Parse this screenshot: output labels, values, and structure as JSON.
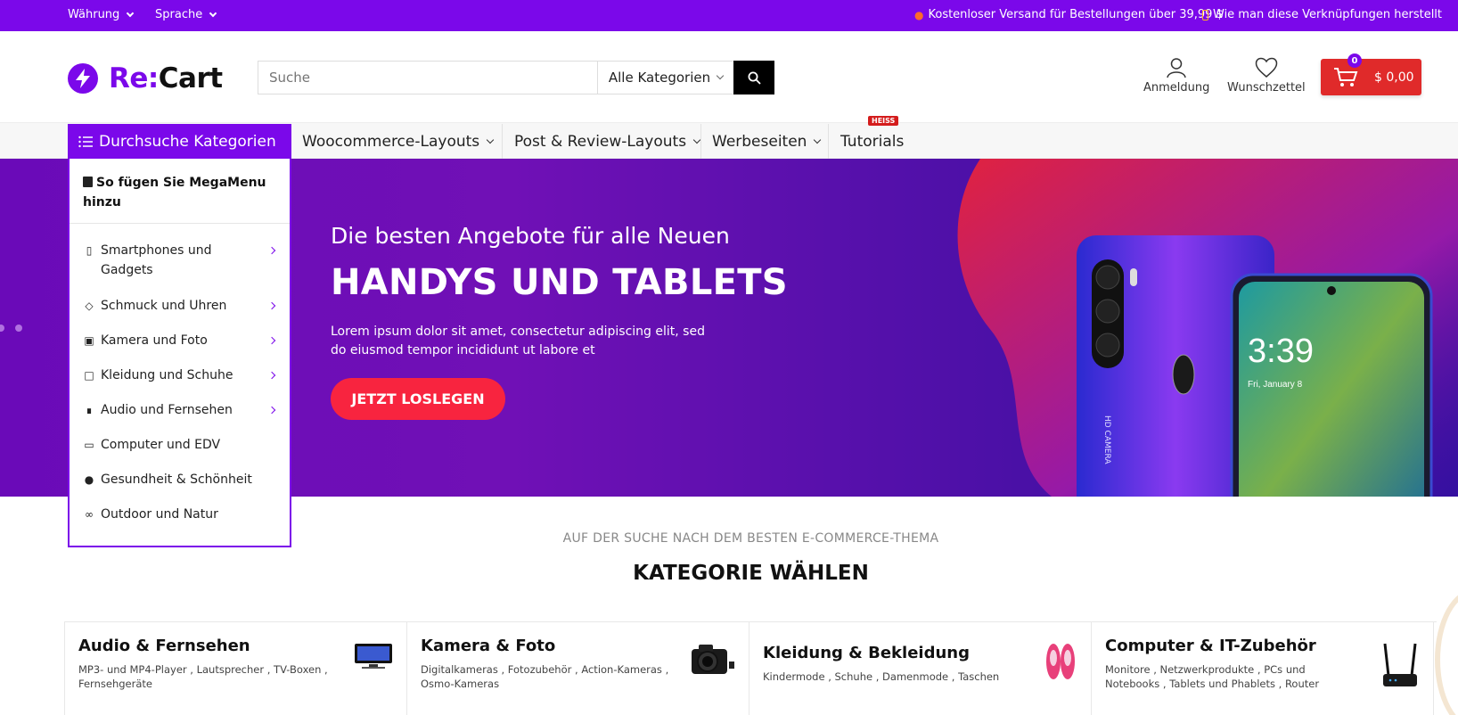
{
  "topbar": {
    "currency": "Währung",
    "language": "Sprache",
    "shipping": "Kostenloser Versand für Bestellungen über 39,99 $",
    "shortcuts": "Wie man diese Verknüpfungen herstellt"
  },
  "logo": {
    "re": "Re:",
    "cart": "Cart"
  },
  "search": {
    "placeholder": "Suche",
    "category": "Alle Kategorien"
  },
  "header": {
    "login": "Anmeldung",
    "wishlist": "Wunschzettel",
    "cart_count": "0",
    "cart_total": "$ 0,00"
  },
  "nav": {
    "browse": "Durchsuche Kategorien",
    "items": [
      "Woocommerce-Layouts",
      "Post & Review-Layouts",
      "Werbeseiten",
      "Tutorials"
    ],
    "hot_badge": "HEISS"
  },
  "menu": {
    "header": "So fügen Sie MegaMenu hinzu",
    "items": [
      "Smartphones und Gadgets",
      "Schmuck und Uhren",
      "Kamera und Foto",
      "Kleidung und Schuhe",
      "Audio und Fernsehen",
      "Computer und EDV",
      "Gesundheit & Schönheit",
      "Outdoor und Natur"
    ]
  },
  "hero": {
    "subtitle": "Die besten Angebote für alle Neuen",
    "title": "HANDYS UND TABLETS",
    "description": "Lorem ipsum dolor sit amet, consectetur adipiscing elit, sed do eiusmod tempor incididunt ut labore et",
    "button": "JETZT LOSLEGEN",
    "phone_time": "3:39",
    "phone_date": "Fri, January 8",
    "phone_back_text": "HD CAMERA"
  },
  "section": {
    "subtitle": "AUF DER SUCHE NACH DEM BESTEN E-COMMERCE-THEMA",
    "title": "KATEGORIE WÄHLEN"
  },
  "categories": [
    {
      "title": "Audio & Fernsehen",
      "sub": "MP3- und MP4-Player , Lautsprecher , TV-Boxen , Fernsehgeräte"
    },
    {
      "title": "Kamera & Foto",
      "sub": "Digitalkameras , Fotozubehör , Action-Kameras , Osmo-Kameras"
    },
    {
      "title": "Kleidung & Bekleidung",
      "sub": "Kindermode , Schuhe , Damenmode , Taschen"
    },
    {
      "title": "Computer & IT-Zubehör",
      "sub": "Monitore , Netzwerkprodukte , PCs und Notebooks , Tablets und Phablets , Router"
    }
  ],
  "colors": {
    "brand": "#7b08ea",
    "accent": "#f8243f",
    "cart": "#e02a2a"
  }
}
